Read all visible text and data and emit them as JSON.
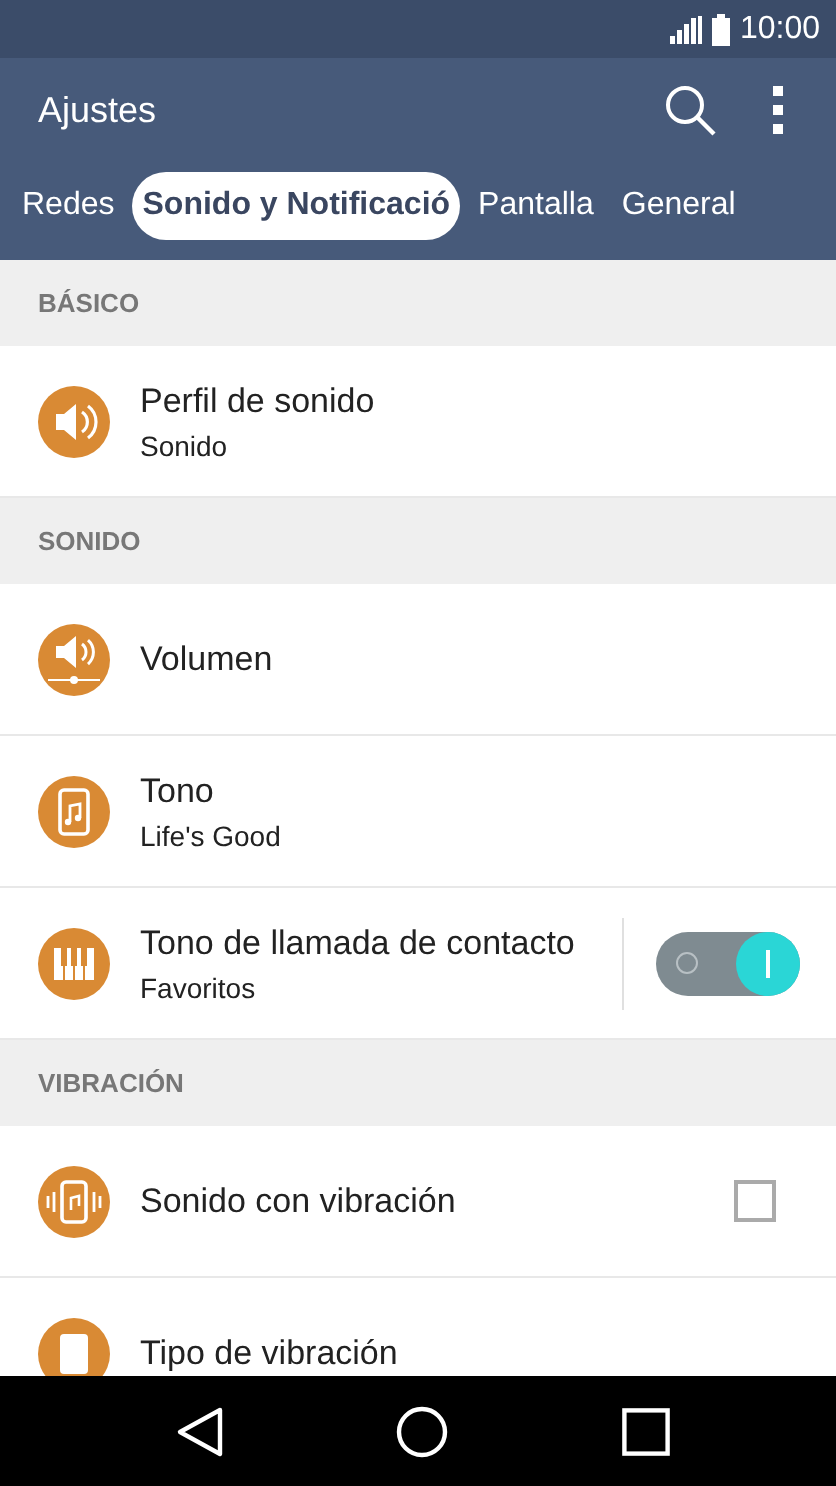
{
  "status_bar": {
    "time": "10:00"
  },
  "app_bar": {
    "title": "Ajustes"
  },
  "tabs": [
    {
      "label": "Redes",
      "selected": false
    },
    {
      "label": "Sonido y Notificació",
      "selected": true
    },
    {
      "label": "Pantalla",
      "selected": false
    },
    {
      "label": "General",
      "selected": false
    }
  ],
  "sections": [
    {
      "header": "BÁSICO",
      "items": [
        {
          "kind": "plain",
          "title": "Perfil de sonido",
          "subtitle": "Sonido"
        }
      ]
    },
    {
      "header": "SONIDO",
      "items": [
        {
          "kind": "plain",
          "title": "Volumen"
        },
        {
          "kind": "plain",
          "title": "Tono",
          "subtitle": "Life's Good"
        },
        {
          "kind": "toggle",
          "title": "Tono de llamada de contacto",
          "subtitle": "Favoritos",
          "on": true
        }
      ]
    },
    {
      "header": "VIBRACIÓN",
      "items": [
        {
          "kind": "checkbox",
          "title": "Sonido con vibración",
          "checked": false
        },
        {
          "kind": "plain",
          "title": "Tipo de vibración"
        }
      ]
    }
  ]
}
